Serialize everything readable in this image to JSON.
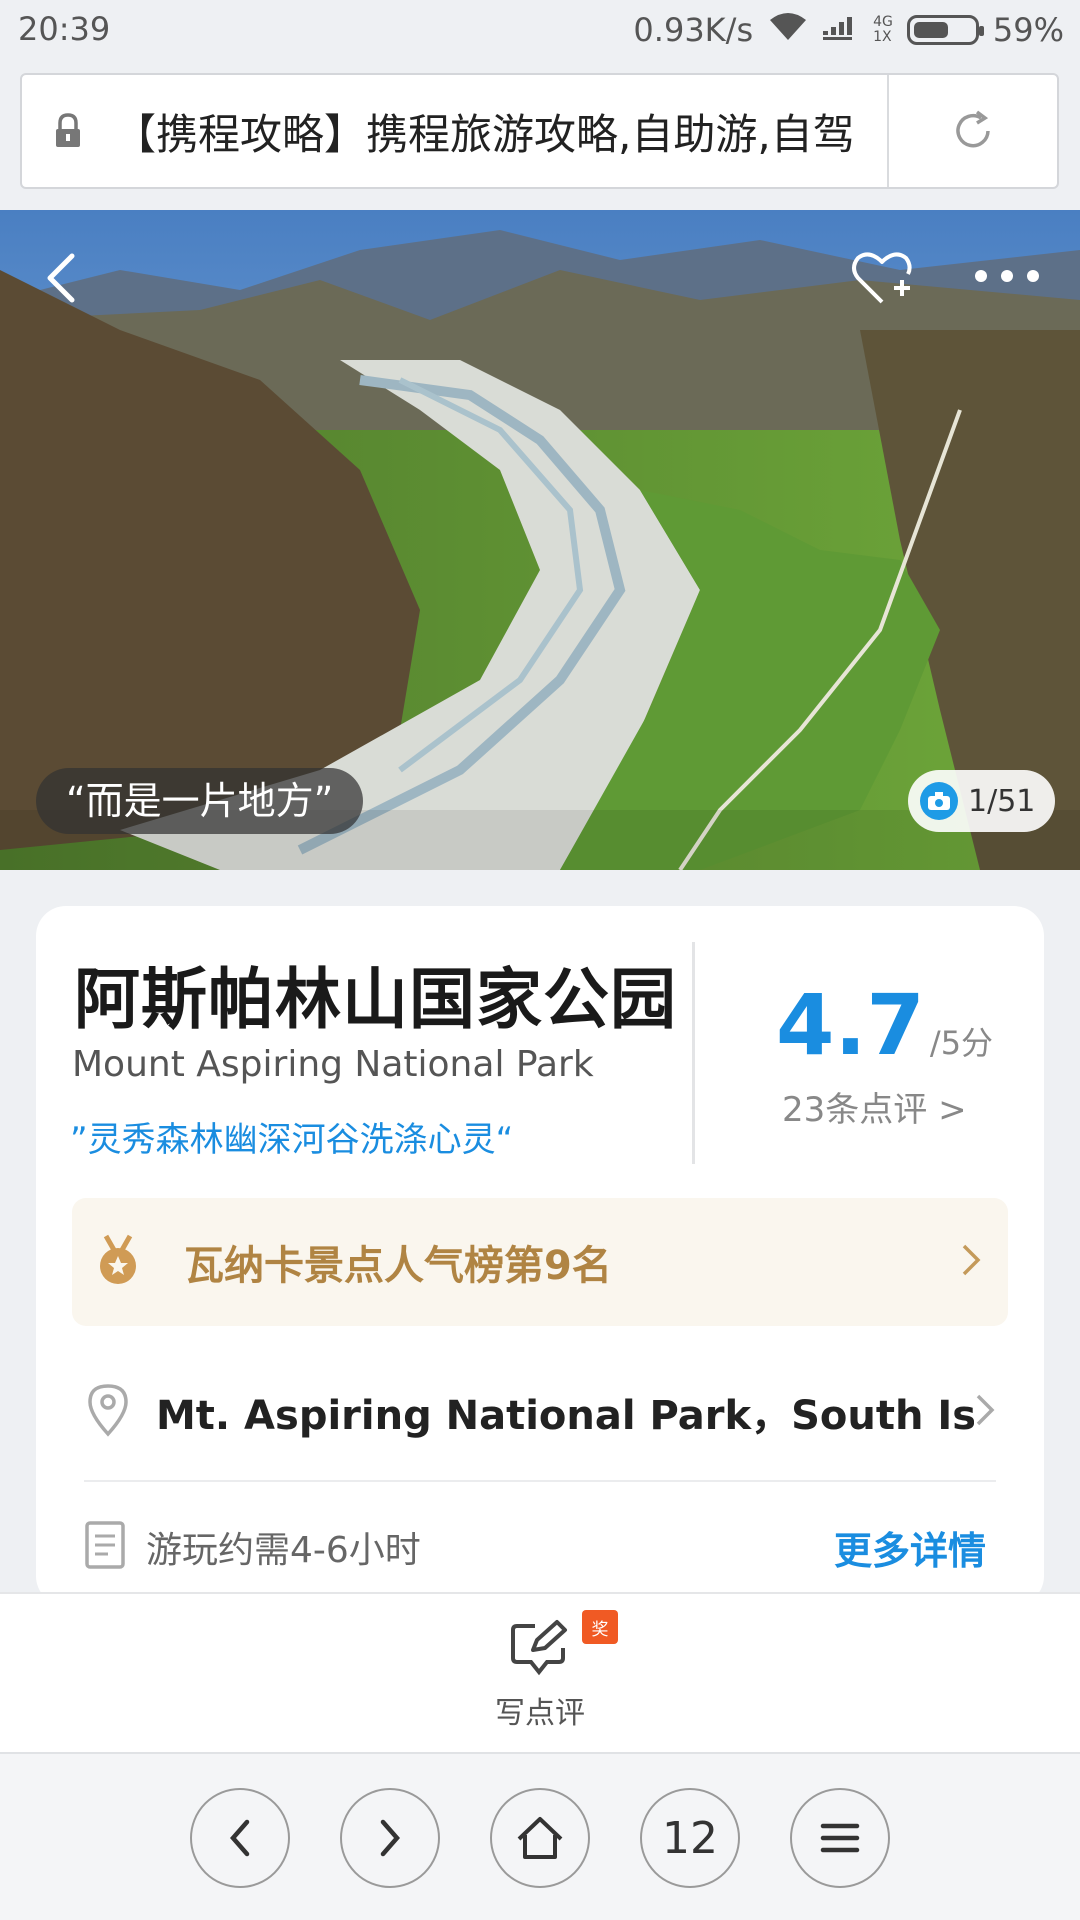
{
  "status_bar": {
    "time": "20:39",
    "speed": "0.93K/s",
    "net_top": "4G",
    "net_bottom": "1X",
    "battery_text": "59%",
    "battery_level": 0.59
  },
  "browser": {
    "url_title": "【携程攻略】携程旅游攻略,自助游,自驾",
    "lock_icon": "lock-icon",
    "reload_icon": "reload-icon"
  },
  "hero": {
    "quote": "“而是一片地方”",
    "photo_counter": "1/51",
    "back_icon": "back-chevron-icon",
    "favorite_icon": "heart-plus-icon",
    "more_icon": "more-dots-icon"
  },
  "attraction": {
    "name_cn": "阿斯帕林山国家公园",
    "name_en": "Mount Aspiring National Park",
    "slogan": "”灵秀森林幽深河谷洗涤心灵“",
    "score": "4.7",
    "score_unit": "/5分",
    "reviews": "23条点评 >",
    "rank_text": "瓦纳卡景点人气榜第9名",
    "address": "Mt. Aspiring National Park，South Isl...",
    "duration": "游玩约需4-6小时",
    "more_details": "更多详情"
  },
  "actions": {
    "write_review": "写点评",
    "badge": "奖"
  },
  "nav": {
    "tabs_count": "12"
  },
  "colors": {
    "accent_blue": "#1a8de0",
    "rank_gold": "#b08443",
    "badge_orange": "#f05a24"
  }
}
